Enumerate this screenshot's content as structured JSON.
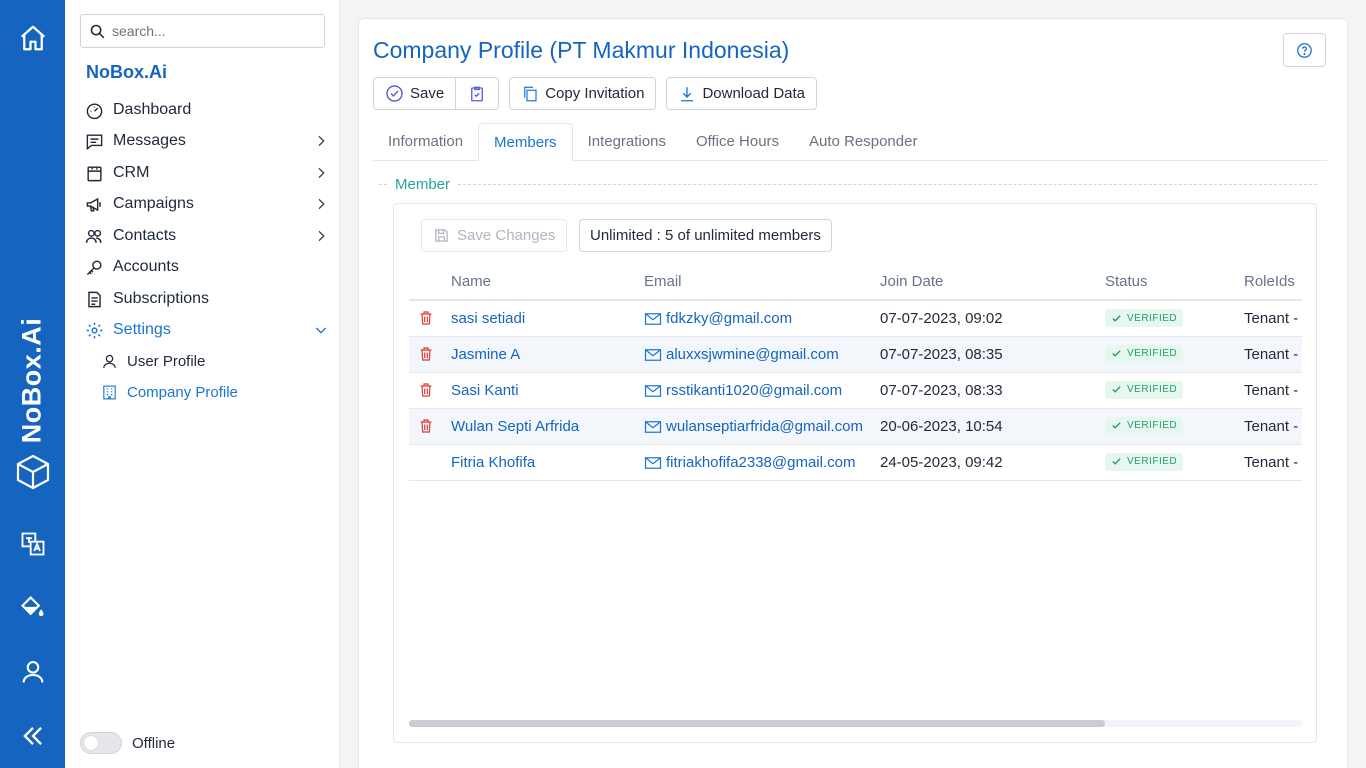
{
  "rail": {
    "logo_text": "NoBox.Ai",
    "icons": [
      "home-icon",
      "translate-icon",
      "paint-bucket-icon",
      "user-icon",
      "collapse-icon"
    ]
  },
  "sidebar": {
    "search_placeholder": "search...",
    "brand": "NoBox.Ai",
    "items": [
      {
        "label": "Dashboard",
        "icon": "dashboard-icon",
        "chevron": false
      },
      {
        "label": "Messages",
        "icon": "messages-icon",
        "chevron": true
      },
      {
        "label": "CRM",
        "icon": "crm-icon",
        "chevron": true
      },
      {
        "label": "Campaigns",
        "icon": "megaphone-icon",
        "chevron": true
      },
      {
        "label": "Contacts",
        "icon": "contacts-icon",
        "chevron": true
      },
      {
        "label": "Accounts",
        "icon": "key-icon",
        "chevron": false
      },
      {
        "label": "Subscriptions",
        "icon": "document-icon",
        "chevron": false
      },
      {
        "label": "Settings",
        "icon": "gear-icon",
        "chevron": true,
        "active": true
      }
    ],
    "sub_items": [
      {
        "label": "User Profile",
        "icon": "user-icon"
      },
      {
        "label": "Company Profile",
        "icon": "building-icon",
        "active": true
      }
    ],
    "status_label": "Offline"
  },
  "main": {
    "title": "Company Profile (PT Makmur Indonesia)",
    "toolbar": {
      "save_label": "Save",
      "copy_invitation_label": "Copy Invitation",
      "download_label": "Download Data"
    },
    "tabs": [
      "Information",
      "Members",
      "Integrations",
      "Office Hours",
      "Auto Responder"
    ],
    "active_tab": "Members",
    "section_label": "Member",
    "save_changes_label": "Save Changes",
    "quota_label": "Unlimited : 5 of unlimited members",
    "table": {
      "columns": [
        "Name",
        "Email",
        "Join Date",
        "Status",
        "RoleIds"
      ],
      "rows": [
        {
          "name": "sasi setiadi",
          "email": "fdkzky@gmail.com",
          "join": "07-07-2023, 09:02",
          "status": "VERIFIED",
          "role": "Tenant -",
          "deletable": true
        },
        {
          "name": "Jasmine A",
          "email": "aluxxsjwmine@gmail.com",
          "join": "07-07-2023, 08:35",
          "status": "VERIFIED",
          "role": "Tenant -",
          "deletable": true
        },
        {
          "name": "Sasi Kanti",
          "email": "rsstikanti1020@gmail.com",
          "join": "07-07-2023, 08:33",
          "status": "VERIFIED",
          "role": "Tenant -",
          "deletable": true
        },
        {
          "name": "Wulan Septi Arfrida",
          "email": "wulanseptiarfrida@gmail.com",
          "join": "20-06-2023, 10:54",
          "status": "VERIFIED",
          "role": "Tenant -",
          "deletable": true
        },
        {
          "name": "Fitria Khofifa",
          "email": "fitriakhofifa2338@gmail.com",
          "join": "24-05-2023, 09:42",
          "status": "VERIFIED",
          "role": "Tenant -",
          "deletable": false
        }
      ]
    }
  },
  "colors": {
    "rail": "#1565c0",
    "accent": "#1976d2",
    "section": "#26a69a",
    "verified_bg": "#e6f7ef",
    "verified_text": "#22a06b",
    "delete": "#e53935"
  }
}
